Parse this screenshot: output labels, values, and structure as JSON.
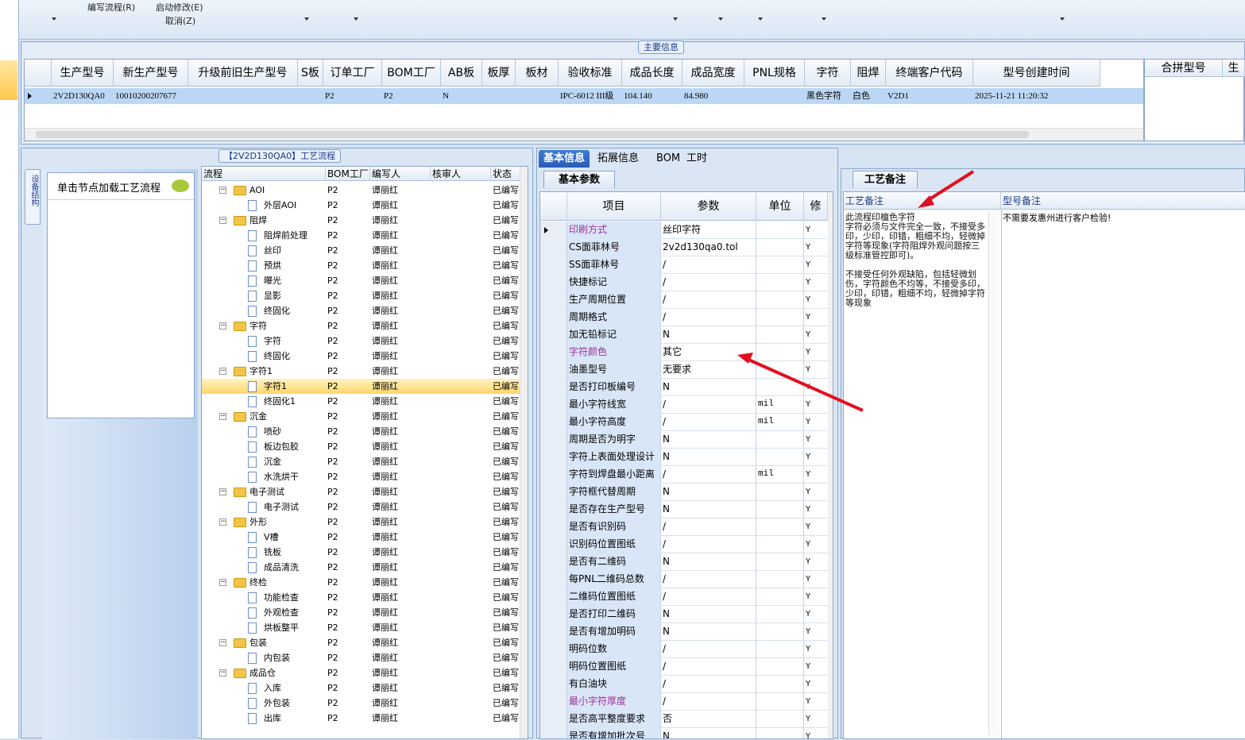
{
  "toolbar": {
    "edit_flow": "编写流程(R)",
    "start_edit": "启动修改(E)",
    "cancel": "取消(Z)"
  },
  "main_info": {
    "title": "主要信息",
    "columns": [
      "生产型号",
      "新生产型号",
      "升级前旧生产型号",
      "S板",
      "订单工厂",
      "BOM工厂",
      "AB板",
      "板厚",
      "板材",
      "验收标准",
      "成品长度",
      "成品宽度",
      "PNL规格",
      "字符",
      "阻焊",
      "终端客户代码",
      "型号创建时间"
    ],
    "row": [
      "2V2D130QA0",
      "10010200207677",
      "",
      "",
      "P2",
      "P2",
      "N",
      "",
      "",
      "IPC-6012 III级",
      "104.140",
      "84.980",
      "",
      "黑色字符",
      "白色",
      "V2D1",
      "2025-11-21 11:20:32"
    ],
    "right_columns": [
      "合拼型号",
      "生"
    ]
  },
  "left": {
    "side_tab": "设备结构",
    "click_hint": "单击节点加载工艺流程"
  },
  "process": {
    "title": "【2V2D130QA0】工艺流程",
    "columns": [
      "流程",
      "BOM工厂",
      "编写人",
      "核审人",
      "状态"
    ],
    "rows": [
      {
        "name": "AOI",
        "level": 0,
        "factory": "P2",
        "writer": "谭丽红",
        "status": "已编写",
        "sel": false
      },
      {
        "name": "外层AOI",
        "level": 1,
        "factory": "P2",
        "writer": "谭丽红",
        "status": "已编写",
        "sel": false
      },
      {
        "name": "阻焊",
        "level": 0,
        "factory": "P2",
        "writer": "谭丽红",
        "status": "已编写",
        "sel": false
      },
      {
        "name": "阻焊前处理",
        "level": 1,
        "factory": "P2",
        "writer": "谭丽红",
        "status": "已编写",
        "sel": false
      },
      {
        "name": "丝印",
        "level": 1,
        "factory": "P2",
        "writer": "谭丽红",
        "status": "已编写",
        "sel": false
      },
      {
        "name": "预烘",
        "level": 1,
        "factory": "P2",
        "writer": "谭丽红",
        "status": "已编写",
        "sel": false
      },
      {
        "name": "曝光",
        "level": 1,
        "factory": "P2",
        "writer": "谭丽红",
        "status": "已编写",
        "sel": false
      },
      {
        "name": "显影",
        "level": 1,
        "factory": "P2",
        "writer": "谭丽红",
        "status": "已编写",
        "sel": false
      },
      {
        "name": "终固化",
        "level": 1,
        "factory": "P2",
        "writer": "谭丽红",
        "status": "已编写",
        "sel": false
      },
      {
        "name": "字符",
        "level": 0,
        "factory": "P2",
        "writer": "谭丽红",
        "status": "已编写",
        "sel": false
      },
      {
        "name": "字符",
        "level": 1,
        "factory": "P2",
        "writer": "谭丽红",
        "status": "已编写",
        "sel": false
      },
      {
        "name": "终固化",
        "level": 1,
        "factory": "P2",
        "writer": "谭丽红",
        "status": "已编写",
        "sel": false
      },
      {
        "name": "字符1",
        "level": 0,
        "factory": "P2",
        "writer": "谭丽红",
        "status": "已编写",
        "sel": false
      },
      {
        "name": "字符1",
        "level": 1,
        "factory": "P2",
        "writer": "谭丽红",
        "status": "已编写",
        "sel": true
      },
      {
        "name": "终固化1",
        "level": 1,
        "factory": "P2",
        "writer": "谭丽红",
        "status": "已编写",
        "sel": false
      },
      {
        "name": "沉金",
        "level": 0,
        "factory": "P2",
        "writer": "谭丽红",
        "status": "已编写",
        "sel": false
      },
      {
        "name": "喷砂",
        "level": 1,
        "factory": "P2",
        "writer": "谭丽红",
        "status": "已编写",
        "sel": false
      },
      {
        "name": "板边包胶",
        "level": 1,
        "factory": "P2",
        "writer": "谭丽红",
        "status": "已编写",
        "sel": false
      },
      {
        "name": "沉金",
        "level": 1,
        "factory": "P2",
        "writer": "谭丽红",
        "status": "已编写",
        "sel": false
      },
      {
        "name": "水洗烘干",
        "level": 1,
        "factory": "P2",
        "writer": "谭丽红",
        "status": "已编写",
        "sel": false
      },
      {
        "name": "电子测试",
        "level": 0,
        "factory": "P2",
        "writer": "谭丽红",
        "status": "已编写",
        "sel": false
      },
      {
        "name": "电子测试",
        "level": 1,
        "factory": "P2",
        "writer": "谭丽红",
        "status": "已编写",
        "sel": false
      },
      {
        "name": "外形",
        "level": 0,
        "factory": "P2",
        "writer": "谭丽红",
        "status": "已编写",
        "sel": false
      },
      {
        "name": "V槽",
        "level": 1,
        "factory": "P2",
        "writer": "谭丽红",
        "status": "已编写",
        "sel": false
      },
      {
        "name": "铣板",
        "level": 1,
        "factory": "P2",
        "writer": "谭丽红",
        "status": "已编写",
        "sel": false
      },
      {
        "name": "成品清洗",
        "level": 1,
        "factory": "P2",
        "writer": "谭丽红",
        "status": "已编写",
        "sel": false
      },
      {
        "name": "终检",
        "level": 0,
        "factory": "P2",
        "writer": "谭丽红",
        "status": "已编写",
        "sel": false
      },
      {
        "name": "功能检查",
        "level": 1,
        "factory": "P2",
        "writer": "谭丽红",
        "status": "已编写",
        "sel": false
      },
      {
        "name": "外观检查",
        "level": 1,
        "factory": "P2",
        "writer": "谭丽红",
        "status": "已编写",
        "sel": false
      },
      {
        "name": "烘板整平",
        "level": 1,
        "factory": "P2",
        "writer": "谭丽红",
        "status": "已编写",
        "sel": false
      },
      {
        "name": "包装",
        "level": 0,
        "factory": "P2",
        "writer": "谭丽红",
        "status": "已编写",
        "sel": false
      },
      {
        "name": "内包装",
        "level": 1,
        "factory": "P2",
        "writer": "谭丽红",
        "status": "已编写",
        "sel": false
      },
      {
        "name": "成品仓",
        "level": 0,
        "factory": "P2",
        "writer": "谭丽红",
        "status": "已编写",
        "sel": false
      },
      {
        "name": "入库",
        "level": 1,
        "factory": "P2",
        "writer": "谭丽红",
        "status": "已编写",
        "sel": false
      },
      {
        "name": "外包装",
        "level": 1,
        "factory": "P2",
        "writer": "谭丽红",
        "status": "已编写",
        "sel": false
      },
      {
        "name": "出库",
        "level": 1,
        "factory": "P2",
        "writer": "谭丽红",
        "status": "已编写",
        "sel": false
      }
    ]
  },
  "params": {
    "tabs": [
      "基本信息",
      "拓展信息",
      "BOM",
      "工时"
    ],
    "subtab": "基本参数",
    "columns": [
      "项目",
      "参数",
      "单位",
      "修"
    ],
    "rows": [
      {
        "item": "印刷方式",
        "value": "丝印字符",
        "unit": "",
        "mod": "Y",
        "pink": true
      },
      {
        "item": "CS面菲林号",
        "value": "2v2d130qa0.tol",
        "unit": "",
        "mod": "Y",
        "pink": false
      },
      {
        "item": "SS面菲林号",
        "value": "/",
        "unit": "",
        "mod": "Y",
        "pink": false
      },
      {
        "item": "快捷标记",
        "value": "/",
        "unit": "",
        "mod": "Y",
        "pink": false
      },
      {
        "item": "生产周期位置",
        "value": "/",
        "unit": "",
        "mod": "Y",
        "pink": false
      },
      {
        "item": "周期格式",
        "value": "/",
        "unit": "",
        "mod": "Y",
        "pink": false
      },
      {
        "item": "加无铅标记",
        "value": "N",
        "unit": "",
        "mod": "Y",
        "pink": false
      },
      {
        "item": "字符颜色",
        "value": "其它",
        "unit": "",
        "mod": "Y",
        "pink": true
      },
      {
        "item": "油墨型号",
        "value": "无要求",
        "unit": "",
        "mod": "Y",
        "pink": false
      },
      {
        "item": "是否打印板编号",
        "value": "N",
        "unit": "",
        "mod": "Y",
        "pink": false
      },
      {
        "item": "最小字符线宽",
        "value": "/",
        "unit": "mil",
        "mod": "Y",
        "pink": false
      },
      {
        "item": "最小字符高度",
        "value": "/",
        "unit": "mil",
        "mod": "Y",
        "pink": false
      },
      {
        "item": "周期是否为明字",
        "value": "N",
        "unit": "",
        "mod": "Y",
        "pink": false
      },
      {
        "item": "字符上表面处理设计",
        "value": "N",
        "unit": "",
        "mod": "Y",
        "pink": false
      },
      {
        "item": "字符到焊盘最小距离",
        "value": "/",
        "unit": "mil",
        "mod": "Y",
        "pink": false
      },
      {
        "item": "字符框代替周期",
        "value": "N",
        "unit": "",
        "mod": "Y",
        "pink": false
      },
      {
        "item": "是否存在生产型号",
        "value": "N",
        "unit": "",
        "mod": "Y",
        "pink": false
      },
      {
        "item": "是否有识别码",
        "value": "/",
        "unit": "",
        "mod": "Y",
        "pink": false
      },
      {
        "item": "识别码位置图纸",
        "value": "/",
        "unit": "",
        "mod": "Y",
        "pink": false
      },
      {
        "item": "是否有二维码",
        "value": "N",
        "unit": "",
        "mod": "Y",
        "pink": false
      },
      {
        "item": "每PNL二维码总数",
        "value": "/",
        "unit": "",
        "mod": "Y",
        "pink": false
      },
      {
        "item": "二维码位置图纸",
        "value": "/",
        "unit": "",
        "mod": "Y",
        "pink": false
      },
      {
        "item": "是否打印二维码",
        "value": "N",
        "unit": "",
        "mod": "Y",
        "pink": false
      },
      {
        "item": "是否有增加明码",
        "value": "N",
        "unit": "",
        "mod": "Y",
        "pink": false
      },
      {
        "item": "明码位数",
        "value": "/",
        "unit": "",
        "mod": "Y",
        "pink": false
      },
      {
        "item": "明码位置图纸",
        "value": "/",
        "unit": "",
        "mod": "Y",
        "pink": false
      },
      {
        "item": "有白油块",
        "value": "/",
        "unit": "",
        "mod": "Y",
        "pink": false
      },
      {
        "item": "最小字符厚度",
        "value": "/",
        "unit": "",
        "mod": "Y",
        "pink": true
      },
      {
        "item": "是否高平整度要求",
        "value": "否",
        "unit": "",
        "mod": "Y",
        "pink": false
      },
      {
        "item": "是否有增加批次号",
        "value": "N",
        "unit": "",
        "mod": "Y",
        "pink": false
      }
    ]
  },
  "remarks": {
    "tab": "工艺备注",
    "craft_header": "工艺备注",
    "model_header": "型号备注",
    "craft_text": "此流程印檀色字符\n字符必须与文件完全一致，不接受多印，少印，印错，粗细不均，轻微掉字符等现象(字符阻焊外观问题按三级标准管控即可)。\n\n不接受任何外观缺陷，包括轻微划伤，字符颜色不均等，不接受多印，少印，印错，粗细不均，轻微掉字符等现象",
    "model_text": "不需要发惠州进行客户检验!"
  },
  "colors": {
    "selected_row": "#bcd7f5",
    "tab_active": "#2a5cb4",
    "annotation_arrow": "#e01020",
    "pink_label": "#a0309a"
  }
}
